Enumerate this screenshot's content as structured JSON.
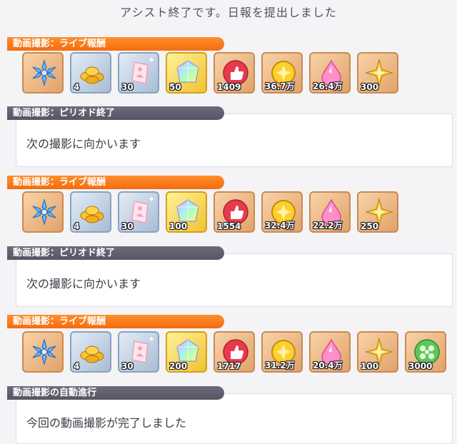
{
  "header": {
    "title": "アシスト終了です。日報を提出しました"
  },
  "sections": [
    {
      "kind": "reward",
      "tag": "動画撮影：ライブ報酬",
      "items": [
        {
          "icon": "blue-snowflake-icon",
          "frame": "bronze",
          "qty": ""
        },
        {
          "icon": "gold-coin-pile-icon",
          "frame": "silver",
          "qty": "4"
        },
        {
          "icon": "pink-ticket-icon",
          "frame": "silver",
          "qty": "30"
        },
        {
          "icon": "rainbow-crystal-icon",
          "frame": "gold",
          "qty": "50"
        },
        {
          "icon": "red-thumbs-up-badge-icon",
          "frame": "bronze",
          "qty": "1409"
        },
        {
          "icon": "gold-coin-icon",
          "frame": "bronze",
          "qty": "36.7万"
        },
        {
          "icon": "pink-drop-gem-icon",
          "frame": "bronze",
          "qty": "26.4万"
        },
        {
          "icon": "gold-star-gem-icon",
          "frame": "bronze",
          "qty": "300"
        }
      ]
    },
    {
      "kind": "message",
      "tag": "動画撮影：ピリオド終了",
      "text": "次の撮影に向かいます"
    },
    {
      "kind": "reward",
      "tag": "動画撮影：ライブ報酬",
      "items": [
        {
          "icon": "blue-snowflake-icon",
          "frame": "bronze",
          "qty": ""
        },
        {
          "icon": "gold-coin-pile-icon",
          "frame": "silver",
          "qty": "4"
        },
        {
          "icon": "pink-ticket-icon",
          "frame": "silver",
          "qty": "30"
        },
        {
          "icon": "rainbow-crystal-icon",
          "frame": "gold",
          "qty": "100"
        },
        {
          "icon": "red-thumbs-up-badge-icon",
          "frame": "bronze",
          "qty": "1554"
        },
        {
          "icon": "gold-coin-icon",
          "frame": "bronze",
          "qty": "32.4万"
        },
        {
          "icon": "pink-drop-gem-icon",
          "frame": "bronze",
          "qty": "22.2万"
        },
        {
          "icon": "gold-star-gem-icon",
          "frame": "bronze",
          "qty": "250"
        }
      ]
    },
    {
      "kind": "message",
      "tag": "動画撮影：ピリオド終了",
      "text": "次の撮影に向かいます"
    },
    {
      "kind": "reward",
      "tag": "動画撮影：ライブ報酬",
      "items": [
        {
          "icon": "blue-snowflake-icon",
          "frame": "bronze",
          "qty": ""
        },
        {
          "icon": "gold-coin-pile-icon",
          "frame": "silver",
          "qty": "4"
        },
        {
          "icon": "pink-ticket-icon",
          "frame": "silver",
          "qty": "30"
        },
        {
          "icon": "rainbow-crystal-icon",
          "frame": "gold",
          "qty": "200"
        },
        {
          "icon": "red-thumbs-up-badge-icon",
          "frame": "bronze",
          "qty": "1717"
        },
        {
          "icon": "gold-coin-icon",
          "frame": "bronze",
          "qty": "31.2万"
        },
        {
          "icon": "pink-drop-gem-icon",
          "frame": "bronze",
          "qty": "20.4万"
        },
        {
          "icon": "gold-star-gem-icon",
          "frame": "bronze",
          "qty": "100"
        },
        {
          "icon": "green-clover-ball-icon",
          "frame": "bronze",
          "qty": "3000"
        }
      ]
    },
    {
      "kind": "message",
      "tag": "動画撮影の自動進行",
      "text": "今回の動画撮影が完了しました"
    }
  ],
  "colors": {
    "reward_tag": "#f47a1c",
    "message_tag": "#625e70",
    "background": "#f4f4f6"
  }
}
